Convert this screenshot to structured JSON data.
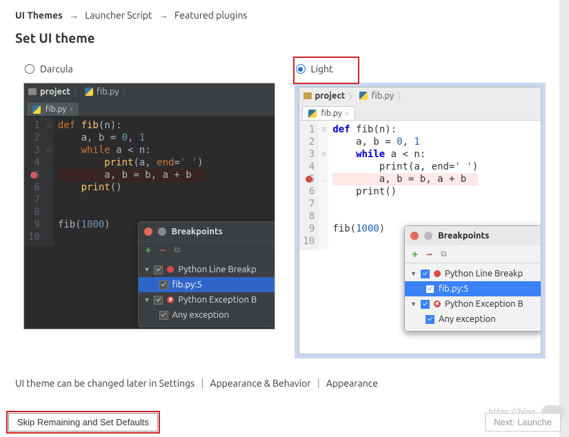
{
  "breadcrumb": {
    "a": "UI Themes",
    "b": "Launcher Script",
    "c": "Featured plugins"
  },
  "heading": "Set UI theme",
  "themes": {
    "darcula_label": "Darcula",
    "light_label": "Light"
  },
  "editor": {
    "project_label": "project",
    "file_label": "fib.py",
    "tab_label": "fib.py",
    "line_numbers": [
      "1",
      "2",
      "3",
      "4",
      "5",
      "6",
      "7",
      "8",
      "9",
      "10"
    ],
    "code": {
      "l1_def": "def",
      "l1_fn": "fib",
      "l1_rest": "(n):",
      "l2_a": "    a",
      "l2_b": " b ",
      "l2_eq": "= ",
      "l2_z": "0",
      "l2_c": ", ",
      "l2_o": "1",
      "l3_while": "    while",
      "l3_rest": " a < n:",
      "l4_print": "        print",
      "l4_open": "(a, ",
      "l4_end": "end",
      "l4_eq": "=",
      "l4_str": "' '",
      "l4_close": ")",
      "l5": "        a, b = b, a + b",
      "l6_print": "    print",
      "l6_rest": "()",
      "l9_a": "fib(",
      "l9_n": "1000",
      "l9_b": ")"
    }
  },
  "breakpoints": {
    "title": "Breakpoints",
    "group1": "Python Line Breakp",
    "item1": "fib.py:5",
    "group2": "Python Exception B",
    "item2": "Any exception"
  },
  "note": {
    "a": "UI theme can be changed later in Settings",
    "b": "Appearance & Behavior",
    "c": "Appearance"
  },
  "footer": {
    "skip": "Skip Remaining and Set Defaults",
    "next": "Next: Launche",
    "watermark_url": "https://blog."
  }
}
